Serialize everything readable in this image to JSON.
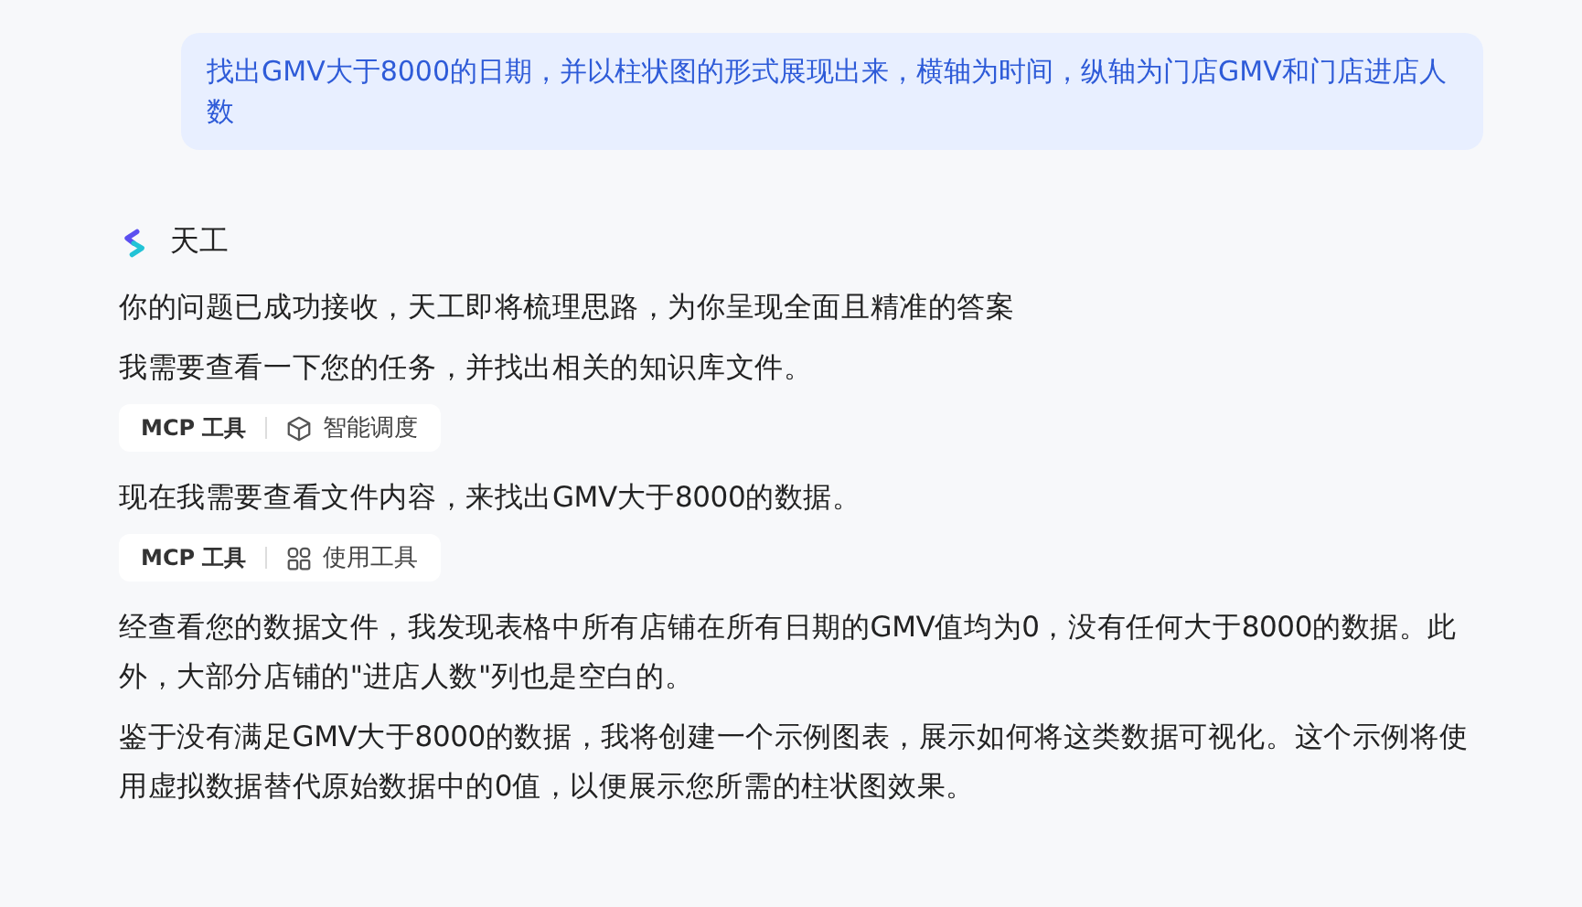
{
  "question": "找出GMV大于8000的日期，并以柱状图的形式展现出来，横轴为时间，纵轴为门店GMV和门店进店人数",
  "assistant": {
    "name": "天工"
  },
  "blocks": [
    {
      "kind": "text",
      "text": "你的问题已成功接收，天工即将梳理思路，为你呈现全面且精准的答案"
    },
    {
      "kind": "text",
      "text": "我需要查看一下您的任务，并找出相关的知识库文件。"
    },
    {
      "kind": "dispatch",
      "tag": "MCP 工具",
      "label": "智能调度"
    },
    {
      "kind": "text",
      "text": "现在我需要查看文件内容，来找出GMV大于8000的数据。"
    },
    {
      "kind": "usetool",
      "tag": "MCP 工具",
      "label": "使用工具"
    },
    {
      "kind": "text",
      "text": "经查看您的数据文件，我发现表格中所有店铺在所有日期的GMV值均为0，没有任何大于8000的数据。此外，大部分店铺的\"进店人数\"列也是空白的。"
    },
    {
      "kind": "text",
      "text": "鉴于没有满足GMV大于8000的数据，我将创建一个示例图表，展示如何将这类数据可视化。这个示例将使用虚拟数据替代原始数据中的0值，以便展示您所需的柱状图效果。"
    }
  ]
}
